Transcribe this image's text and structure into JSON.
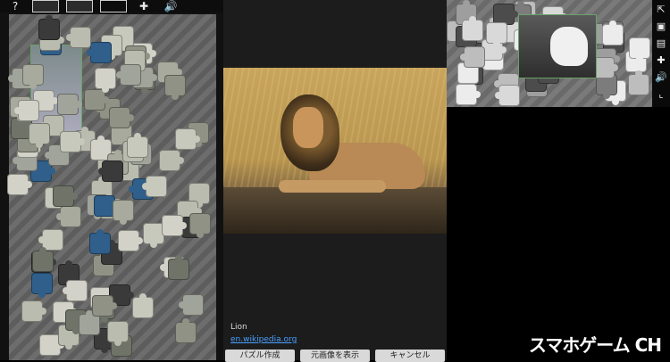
{
  "info": {
    "caption": "Lion",
    "source_link": "en.wikipedia.org",
    "buttons": [
      "パズル作成",
      "元画像を表示",
      "キャンセル"
    ]
  },
  "toolbar_left": {
    "icons": [
      "help-icon",
      "image-frame-icon",
      "preview-icon",
      "empty-box-icon",
      "puzzle-icon",
      "sound-icon"
    ],
    "help_glyph": "?",
    "puzzle_glyph": "✚",
    "sound_glyph": "🔊"
  },
  "toolbar_right": {
    "icons": [
      "share-icon",
      "preview-icon",
      "frame-icon",
      "puzzle-icon",
      "sound-icon",
      "corner-icon"
    ],
    "glyphs": [
      "⇱",
      "▣",
      "▤",
      "✚",
      "🔊",
      "⌞"
    ]
  },
  "watermark": "スマホゲーム CH",
  "colors": {
    "link": "#4aa0ff",
    "preview_border": "#6aa26a",
    "button_bg": "#d9d9d9"
  }
}
